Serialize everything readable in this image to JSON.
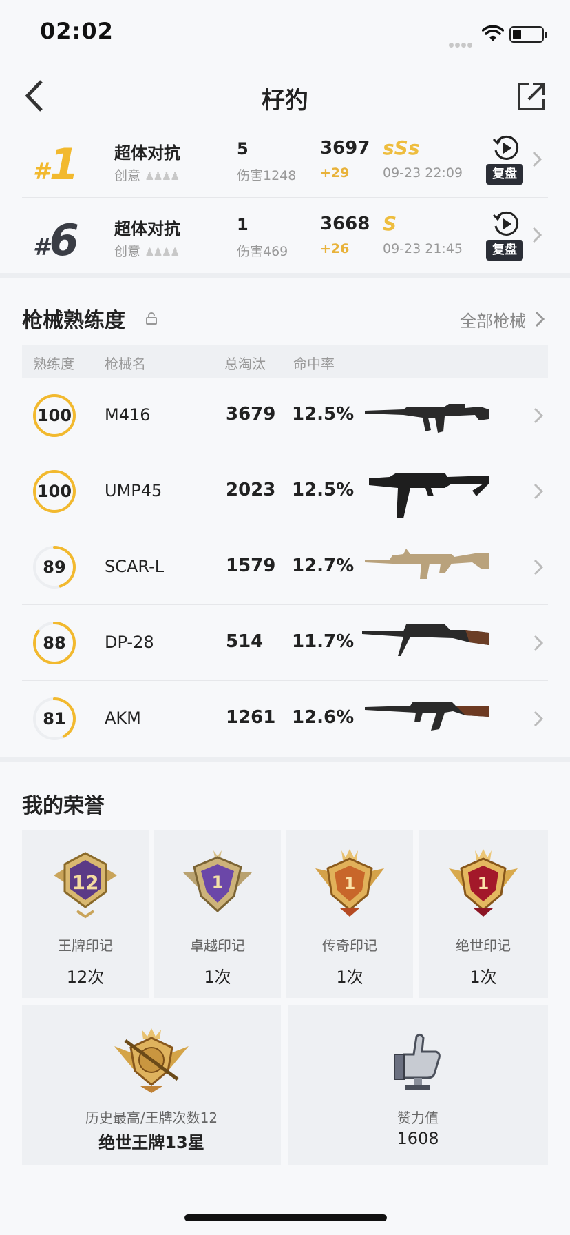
{
  "status_bar": {
    "time": "02:02"
  },
  "header": {
    "title": "杍犳"
  },
  "matches": [
    {
      "rank_num": "1",
      "mode": "超体对抗",
      "sub": "创意",
      "kills": "5",
      "damage": "伤害1248",
      "score": "3697",
      "delta": "+29",
      "grade": "sSs",
      "time": "09-23 22:09",
      "replay_label": "复盘",
      "rank_color": "#f2b92e"
    },
    {
      "rank_num": "6",
      "mode": "超体对抗",
      "sub": "创意",
      "kills": "1",
      "damage": "伤害469",
      "score": "3668",
      "delta": "+26",
      "grade": "S",
      "time": "09-23 21:45",
      "replay_label": "复盘",
      "rank_color": "#3a3d45"
    }
  ],
  "weapons_section": {
    "title": "枪械熟练度",
    "all_label": "全部枪械",
    "headers": {
      "proficiency": "熟练度",
      "name": "枪械名",
      "kills": "总淘汰",
      "hit_rate": "命中率"
    },
    "rows": [
      {
        "proficiency": "100",
        "progress": 1.0,
        "name": "M416",
        "kills": "3679",
        "rate": "12.5%",
        "gun_icon": "m416-rifle-icon"
      },
      {
        "proficiency": "100",
        "progress": 1.0,
        "name": "UMP45",
        "kills": "2023",
        "rate": "12.5%",
        "gun_icon": "ump45-smg-icon"
      },
      {
        "proficiency": "89",
        "progress": 0.45,
        "name": "SCAR-L",
        "kills": "1579",
        "rate": "12.7%",
        "gun_icon": "scar-l-rifle-icon"
      },
      {
        "proficiency": "88",
        "progress": 0.85,
        "name": "DP-28",
        "kills": "514",
        "rate": "11.7%",
        "gun_icon": "dp28-lmg-icon"
      },
      {
        "proficiency": "81",
        "progress": 0.42,
        "name": "AKM",
        "kills": "1261",
        "rate": "12.6%",
        "gun_icon": "akm-rifle-icon"
      }
    ]
  },
  "honors_section": {
    "title": "我的荣誉",
    "cards": [
      {
        "label": "王牌印记",
        "value": "12次",
        "badge_text": "12",
        "icon": "ace-mark-badge-icon"
      },
      {
        "label": "卓越印记",
        "value": "1次",
        "badge_text": "1",
        "icon": "excellence-mark-badge-icon"
      },
      {
        "label": "传奇印记",
        "value": "1次",
        "badge_text": "1",
        "icon": "legend-mark-badge-icon"
      },
      {
        "label": "绝世印记",
        "value": "1次",
        "badge_text": "1",
        "icon": "peerless-mark-badge-icon"
      }
    ],
    "highest": {
      "label": "历史最高/王牌次数12",
      "value": "绝世王牌13星",
      "icon": "peerless-ace-crest-icon"
    },
    "likes": {
      "label": "赞力值",
      "value": "1608",
      "icon": "thumbs-up-trophy-icon"
    }
  },
  "colors": {
    "accent": "#f2b92e",
    "grade": "#eebd3e",
    "delta": "#e8b23a",
    "ring_track": "#eceef1"
  }
}
